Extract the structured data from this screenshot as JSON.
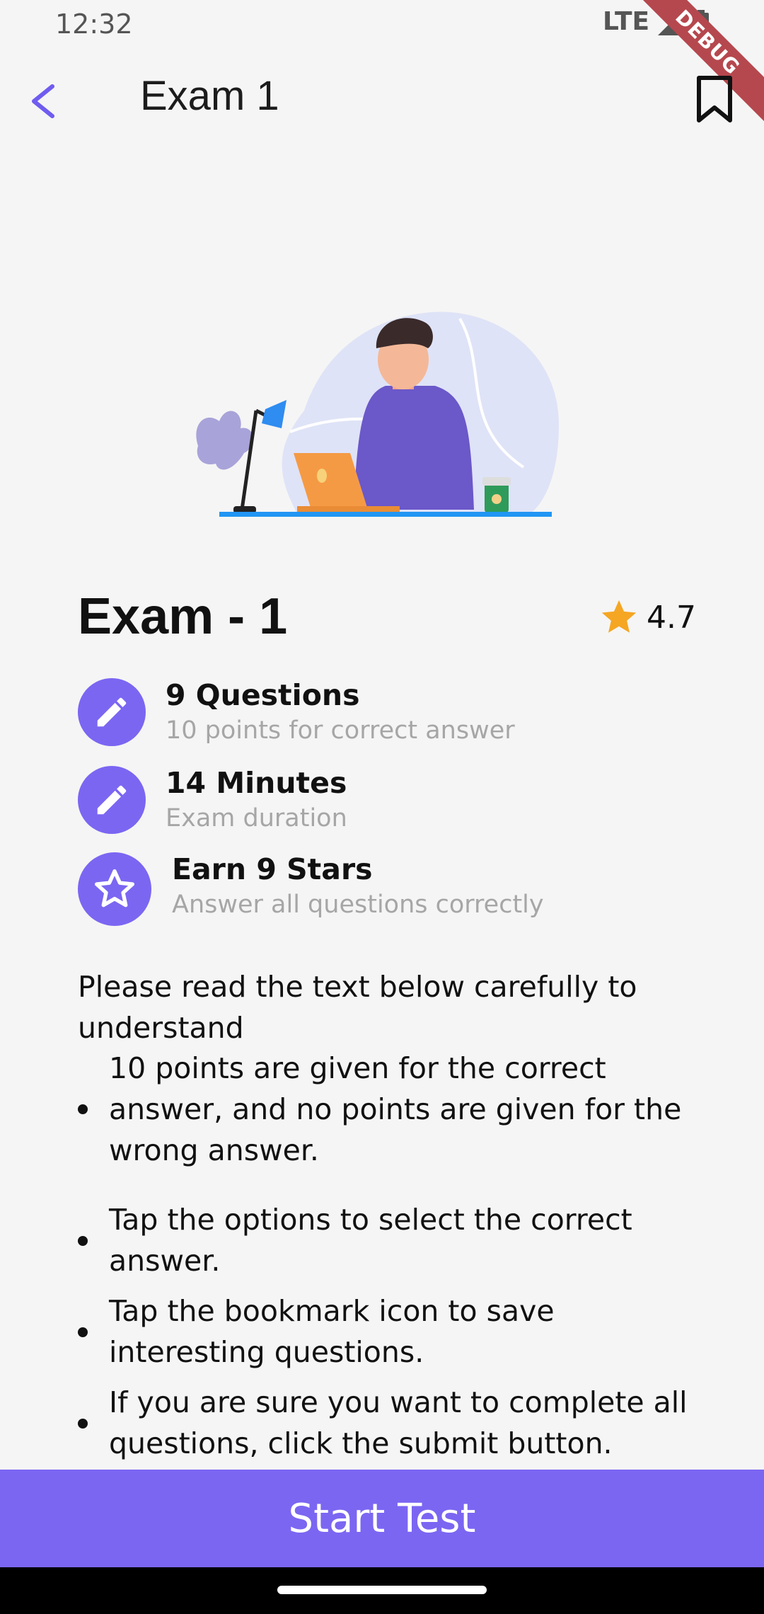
{
  "status_bar": {
    "time": "12:32",
    "network": "LTE",
    "debug_label": "DEBUG"
  },
  "app_bar": {
    "title": "Exam 1"
  },
  "exam": {
    "heading": "Exam - 1",
    "rating": "4.7",
    "info": [
      {
        "title": "9 Questions",
        "subtitle": "10 points for correct answer",
        "icon": "pencil-icon"
      },
      {
        "title": "14 Minutes",
        "subtitle": "Exam duration",
        "icon": "pencil-icon"
      },
      {
        "title": "Earn 9 Stars",
        "subtitle": "Answer all questions correctly",
        "icon": "star-outline-icon"
      }
    ],
    "intro": "Please read the text below carefully to understand",
    "rules": [
      "10 points are given for the correct answer, and no points are given for the wrong answer.",
      "Tap the options to select the correct answer.",
      "Tap the bookmark icon to save interesting questions.",
      "If you are sure you want to complete all questions, click the submit button."
    ]
  },
  "actions": {
    "start_label": "Start Test"
  },
  "colors": {
    "accent": "#7b66f2",
    "star": "#f5a623",
    "subtext": "#a6a6a6"
  }
}
